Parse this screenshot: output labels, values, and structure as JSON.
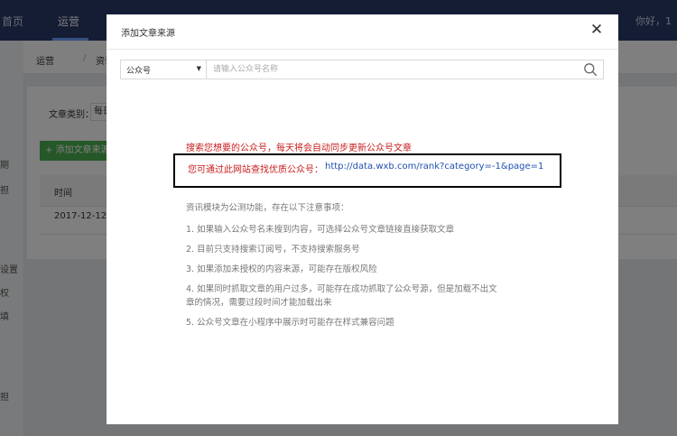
{
  "topbar": {
    "home_label": "首页",
    "ops_label": "运营",
    "user_text": "你好，1"
  },
  "sidebar": {
    "items": [
      "期",
      "担",
      "设置",
      "权",
      "填",
      "担"
    ]
  },
  "breadcrumb": {
    "level1": "运营",
    "separator": "/",
    "level2": "资讯模块"
  },
  "page": {
    "filter_label": "文章类别：",
    "filter_value": "每日",
    "add_button_label": "+ 添加文章来源",
    "table": {
      "headers": [
        "时间"
      ],
      "rows": [
        [
          "2017-12-12"
        ]
      ]
    }
  },
  "modal": {
    "title": "添加文章来源",
    "close_icon": "close-icon",
    "search": {
      "select_value": "公众号",
      "input_value": "",
      "placeholder": "请输入公众号名称",
      "icon": "search-icon"
    },
    "notice": "搜索您想要的公众号，每天将会自动同步更新公众号文章",
    "hint_label": "您可通过此网站查找优质公众号：",
    "hint_link": "http://data.wxb.com/rank?category=-1&page=1",
    "tips_heading": "资讯模块为公测功能，存在以下注意事项：",
    "tips": [
      "1. 如果输入公众号名未搜到内容，可选择公众号文章链接直接获取文章",
      "2. 目前只支持搜索订阅号，不支持搜索服务号",
      "3. 如果添加未授权的内容来源，可能存在版权风险",
      "4. 如果同时抓取文章的用户过多，可能存在成功抓取了公众号源，但是加载不出文章的情况，需要过段时间才能加载出来",
      "5. 公众号文章在小程序中展示时可能存在样式兼容问题"
    ]
  },
  "colors": {
    "notice_red": "#c81e1e",
    "link_blue": "#1f4fb0",
    "nav_bg": "#2b3a6b",
    "add_green": "#4caf50"
  }
}
